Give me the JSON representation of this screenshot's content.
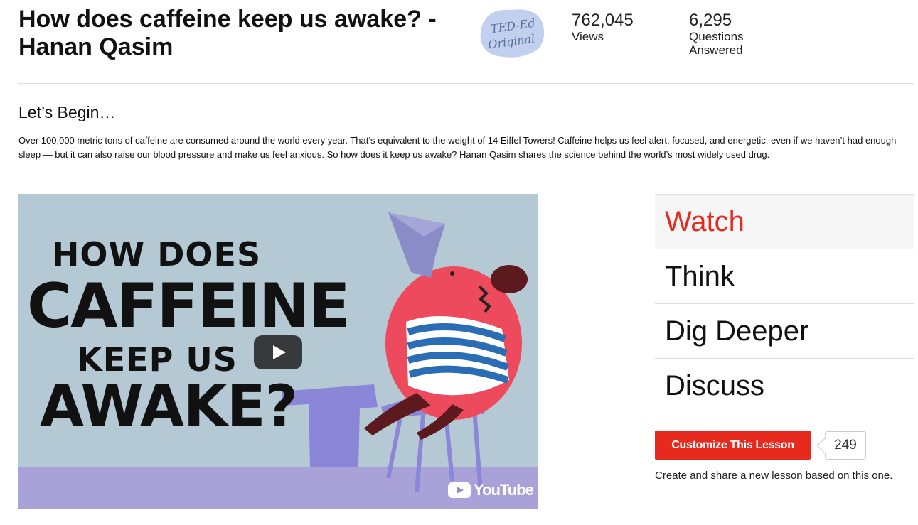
{
  "lesson": {
    "title": "How does caffeine keep us awake? - Hanan Qasim",
    "badge_text_line1": "TED-Ed",
    "badge_text_line2": "Original"
  },
  "stats": {
    "views_value": "762,045",
    "views_label": "Views",
    "answered_value": "6,295",
    "answered_label_line1": "Questions",
    "answered_label_line2": "Answered"
  },
  "intro": {
    "heading": "Let’s Begin…",
    "description": "Over 100,000 metric tons of caffeine are consumed around the world every year. That’s equivalent to the weight of 14 Eiffel Towers! Caffeine helps us feel alert, focused, and energetic, even if we haven’t had enough sleep — but it can also raise our blood pressure and make us feel anxious. So how does it keep us awake? Hanan Qasim shares the science behind the world’s most widely used drug."
  },
  "video": {
    "thumbnail_text_line1": "HOW DOES",
    "thumbnail_text_line2": "CAFFEINE",
    "thumbnail_text_line3": "KEEP US",
    "thumbnail_text_line4": "AWAKE?",
    "youtube_label": "YouTube",
    "play_icon": "play-icon"
  },
  "tabs": [
    {
      "label": "Watch",
      "active": true
    },
    {
      "label": "Think",
      "active": false
    },
    {
      "label": "Dig Deeper",
      "active": false
    },
    {
      "label": "Discuss",
      "active": false
    }
  ],
  "customize": {
    "button_label": "Customize This Lesson",
    "count": "249",
    "note": "Create and share a new lesson based on this one."
  },
  "colors": {
    "accent": "#e62b1e",
    "video_background": "#b4c9d3",
    "tab_active_bg": "#f6f6f6"
  }
}
